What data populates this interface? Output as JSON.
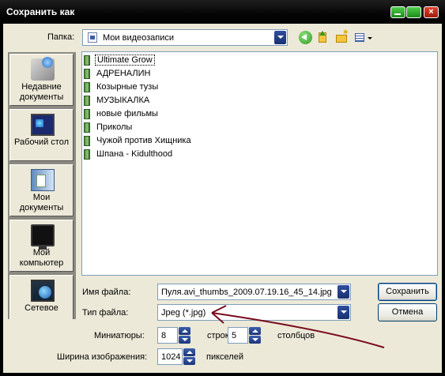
{
  "window": {
    "title": "Сохранить как",
    "close_glyph": "×"
  },
  "toolbar": {
    "folder_label": "Папка:",
    "folder_value": "Мои видеозаписи"
  },
  "places": [
    {
      "label_line1": "Недавние",
      "label_line2": "документы",
      "icon": "recent-documents-icon"
    },
    {
      "label_line1": "Рабочий стол",
      "label_line2": "",
      "icon": "desktop-icon"
    },
    {
      "label_line1": "Мои документы",
      "label_line2": "",
      "icon": "my-documents-icon"
    },
    {
      "label_line1": "Мой",
      "label_line2": "компьютер",
      "icon": "my-computer-icon"
    },
    {
      "label_line1": "Сетевое",
      "label_line2": "",
      "icon": "network-icon"
    }
  ],
  "files": [
    "Ultimate Grow",
    "АДРЕНАЛИН",
    "Козырные тузы",
    "МУЗЫКАЛКА",
    "новые фильмы",
    "Приколы",
    "Чужой против Хищника",
    "Шпана - Kidulthood"
  ],
  "form": {
    "filename_label": "Имя файла:",
    "filename_value": "Пуля.avi_thumbs_2009.07.19.16_45_14.jpg",
    "filetype_label": "Тип файла:",
    "filetype_value": "Jpeg (*.jpg)",
    "save_label": "Сохранить",
    "cancel_label": "Отмена"
  },
  "options": {
    "thumbs_label": "Миниатюры:",
    "rows_value": "8",
    "rows_label": "строк",
    "cols_value": "5",
    "cols_label": "столбцов",
    "width_label": "Ширина изображения:",
    "width_value": "1024",
    "width_unit": "пикселей"
  },
  "colors": {
    "dialog_bg": "#ece9d8",
    "annotation_arrow": "#7a0a1e"
  }
}
